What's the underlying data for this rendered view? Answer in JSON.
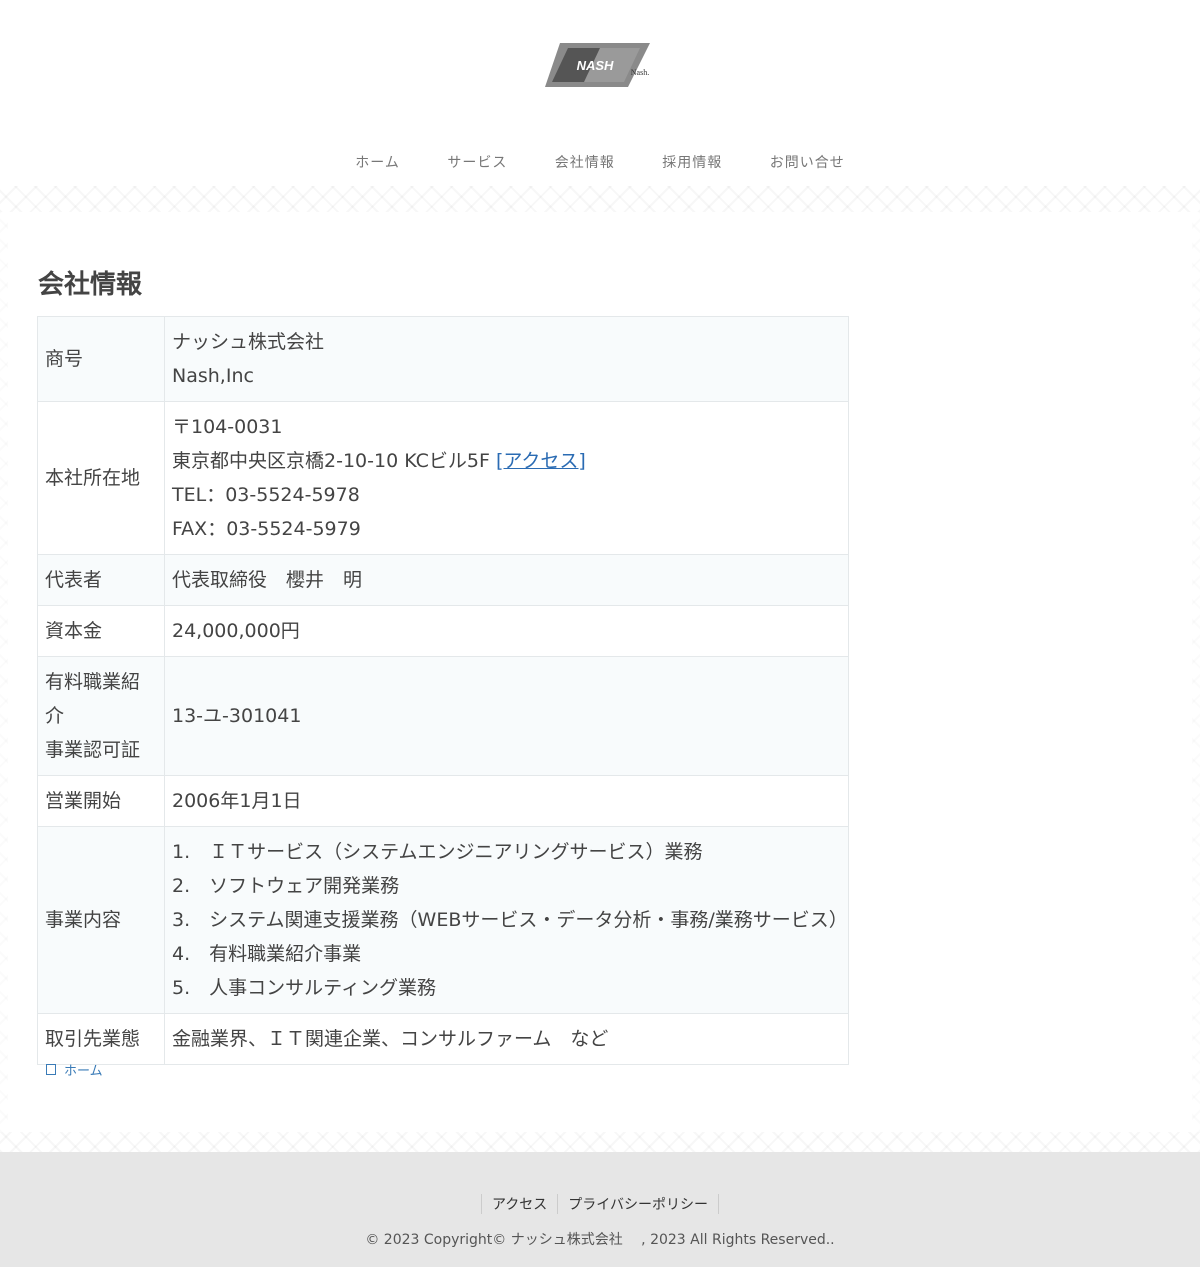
{
  "header": {
    "logo_text": "NASH",
    "logo_subtext": "Nash."
  },
  "nav": {
    "items": [
      {
        "label": "ホーム"
      },
      {
        "label": "サービス"
      },
      {
        "label": "会社情報"
      },
      {
        "label": "採用情報"
      },
      {
        "label": "お問い合せ"
      }
    ]
  },
  "page": {
    "title": "会社情報"
  },
  "company_table": {
    "rows": [
      {
        "label": "商号",
        "lines": [
          "ナッシュ株式会社",
          "Nash,Inc"
        ]
      },
      {
        "label": "本社所在地",
        "lines": [
          "〒104-0031",
          "東京都中央区京橋2-10-10 KCビル5F",
          "TEL：03-5524-5978",
          "FAX：03-5524-5979"
        ],
        "link": "[アクセス]"
      },
      {
        "label": "代表者",
        "lines": [
          "代表取締役　櫻井　明"
        ]
      },
      {
        "label": "資本金",
        "lines": [
          "24,000,000円"
        ]
      },
      {
        "label_lines": [
          "有料職業紹介",
          "事業認可証"
        ],
        "lines": [
          "13-ユ-301041"
        ]
      },
      {
        "label": "営業開始",
        "lines": [
          "2006年1月1日"
        ]
      },
      {
        "label": "事業内容",
        "lines": [
          "1.　ＩＴサービス（システムエンジニアリングサービス）業務",
          "2.　ソフトウェア開発業務",
          "3.　システム関連支援業務（WEBサービス・データ分析・事務/業務サービス）",
          "4.　有料職業紹介事業",
          "5.　人事コンサルティング業務"
        ]
      },
      {
        "label": "取引先業態",
        "lines": [
          "金融業界、ＩＴ関連企業、コンサルファーム　など"
        ]
      }
    ]
  },
  "breadcrumb": {
    "home_label": "ホーム"
  },
  "footer": {
    "links": [
      {
        "label": "アクセス"
      },
      {
        "label": "プライバシーポリシー"
      }
    ],
    "copyright": "© 2023 Copyright© ナッシュ株式会社　 , 2023 All Rights Reserved.."
  }
}
